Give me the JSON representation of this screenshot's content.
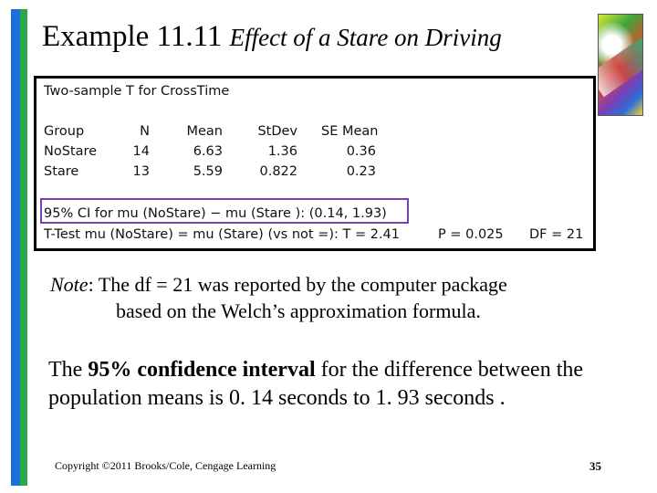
{
  "title": {
    "main": "Example 11.11",
    "subtitle": "Effect of a Stare on Driving"
  },
  "output": {
    "heading": "Two-sample T for CrossTime",
    "columns": [
      "Group",
      "N",
      "Mean",
      "StDev",
      "SE Mean"
    ],
    "rows": [
      [
        "NoStare",
        "14",
        "6.63",
        "1.36",
        "0.36"
      ],
      [
        "Stare",
        "13",
        "5.59",
        "0.822",
        "0.23"
      ]
    ],
    "ci_line": "95% CI for mu (NoStare) − mu (Stare ): (0.14, 1.93)",
    "ttest_line": "T-Test mu (NoStare) = mu (Stare) (vs not =): T = 2.41",
    "p_value": "P = 0.025",
    "df": "DF = 21"
  },
  "note": {
    "label": "Note",
    "line1": ":   The df = 21 was reported by the computer package",
    "line2": "based on the Welch’s approximation formula."
  },
  "conclusion": {
    "prefix": "The ",
    "bold": "95% confidence interval",
    "suffix": " for the difference between the population means is 0. 14 seconds to 1. 93 seconds ."
  },
  "footer": {
    "copyright": "Copyright ©2011 Brooks/Cole, Cengage Learning",
    "page": "35"
  },
  "colors": {
    "sidebar_blue": "#1c6fd6",
    "sidebar_green": "#29a84a",
    "ci_highlight": "#7b3fb5"
  }
}
